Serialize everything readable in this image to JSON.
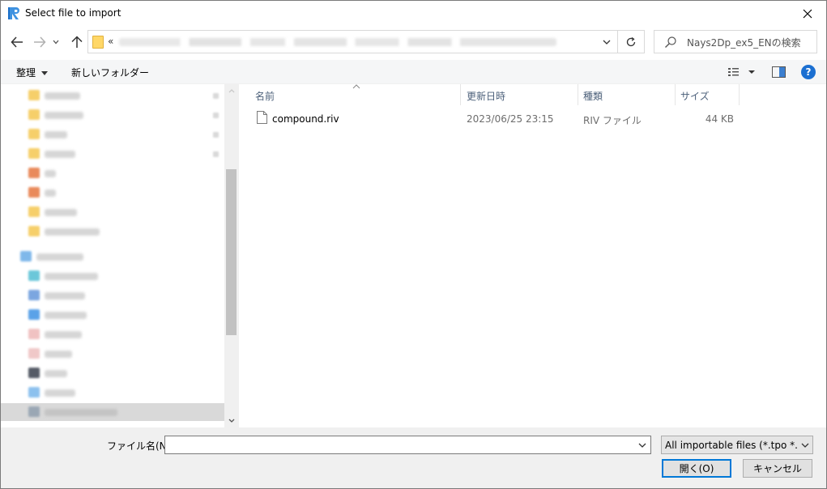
{
  "window": {
    "title": "Select file to import"
  },
  "address": {
    "chevron": "«",
    "search_placeholder": "Nays2Dp_ex5_ENの検索"
  },
  "toolbar": {
    "organize_label": "整理",
    "new_folder_label": "新しいフォルダー"
  },
  "help": {
    "label": "?"
  },
  "columns": [
    {
      "label": "名前"
    },
    {
      "label": "更新日時"
    },
    {
      "label": "種類"
    },
    {
      "label": "サイズ"
    }
  ],
  "files": [
    {
      "name": "compound.riv",
      "modified": "2023/06/25 23:15",
      "type": "RIV ファイル",
      "size": "44 KB"
    }
  ],
  "bottom": {
    "filename_label": "ファイル名(N):",
    "filename_value": "",
    "filter_value": "All importable files (*.tpo *.csv *.riv)",
    "open_label": "開く(O)",
    "cancel_label": "キャンセル"
  },
  "colors": {
    "accent": "#0078d7",
    "help_bg": "#1b6fd1",
    "folder": "#ffd767",
    "header_text": "#4c607a"
  }
}
